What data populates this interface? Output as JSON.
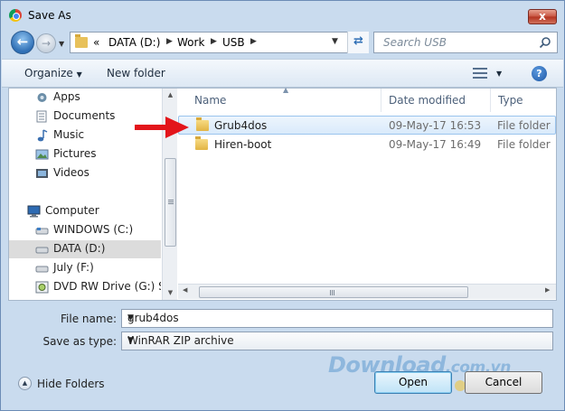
{
  "window": {
    "title": "Save As",
    "close_label": "x"
  },
  "nav": {
    "breadcrumb_prefix": "«",
    "breadcrumbs": [
      "DATA (D:)",
      "Work",
      "USB"
    ],
    "search_placeholder": "Search USB"
  },
  "toolbar": {
    "organize_label": "Organize",
    "new_folder_label": "New folder",
    "help_label": "?"
  },
  "sidebar": {
    "items": [
      {
        "label": "Apps",
        "icon": "apps-icon"
      },
      {
        "label": "Documents",
        "icon": "documents-icon"
      },
      {
        "label": "Music",
        "icon": "music-icon"
      },
      {
        "label": "Pictures",
        "icon": "pictures-icon"
      },
      {
        "label": "Videos",
        "icon": "videos-icon"
      },
      {
        "label": "Computer",
        "icon": "computer-icon"
      },
      {
        "label": "WINDOWS (C:)",
        "icon": "drive-icon"
      },
      {
        "label": "DATA (D:)",
        "icon": "drive-icon",
        "selected": true
      },
      {
        "label": "July (F:)",
        "icon": "drive-icon"
      },
      {
        "label": "DVD RW Drive (G:) Sec",
        "icon": "dvd-icon"
      }
    ]
  },
  "file_list": {
    "columns": [
      "Name",
      "Date modified",
      "Type"
    ],
    "rows": [
      {
        "name": "Grub4dos",
        "date": "09-May-17 16:53",
        "type": "File folder",
        "selected": true
      },
      {
        "name": "Hiren-boot",
        "date": "09-May-17 16:49",
        "type": "File folder",
        "selected": false
      }
    ]
  },
  "form": {
    "file_name_label": "File name:",
    "file_name_value": "grub4dos",
    "save_type_label": "Save as type:",
    "save_type_value": "WinRAR ZIP archive"
  },
  "footer": {
    "hide_folders_label": "Hide Folders",
    "open_label": "Open",
    "cancel_label": "Cancel"
  },
  "watermark": {
    "brand": "Download",
    "suffix": ".com.vn"
  },
  "colors": {
    "accent": "#2f6fb5",
    "arrow": "#e3151b",
    "selection": "#d9eafb"
  }
}
